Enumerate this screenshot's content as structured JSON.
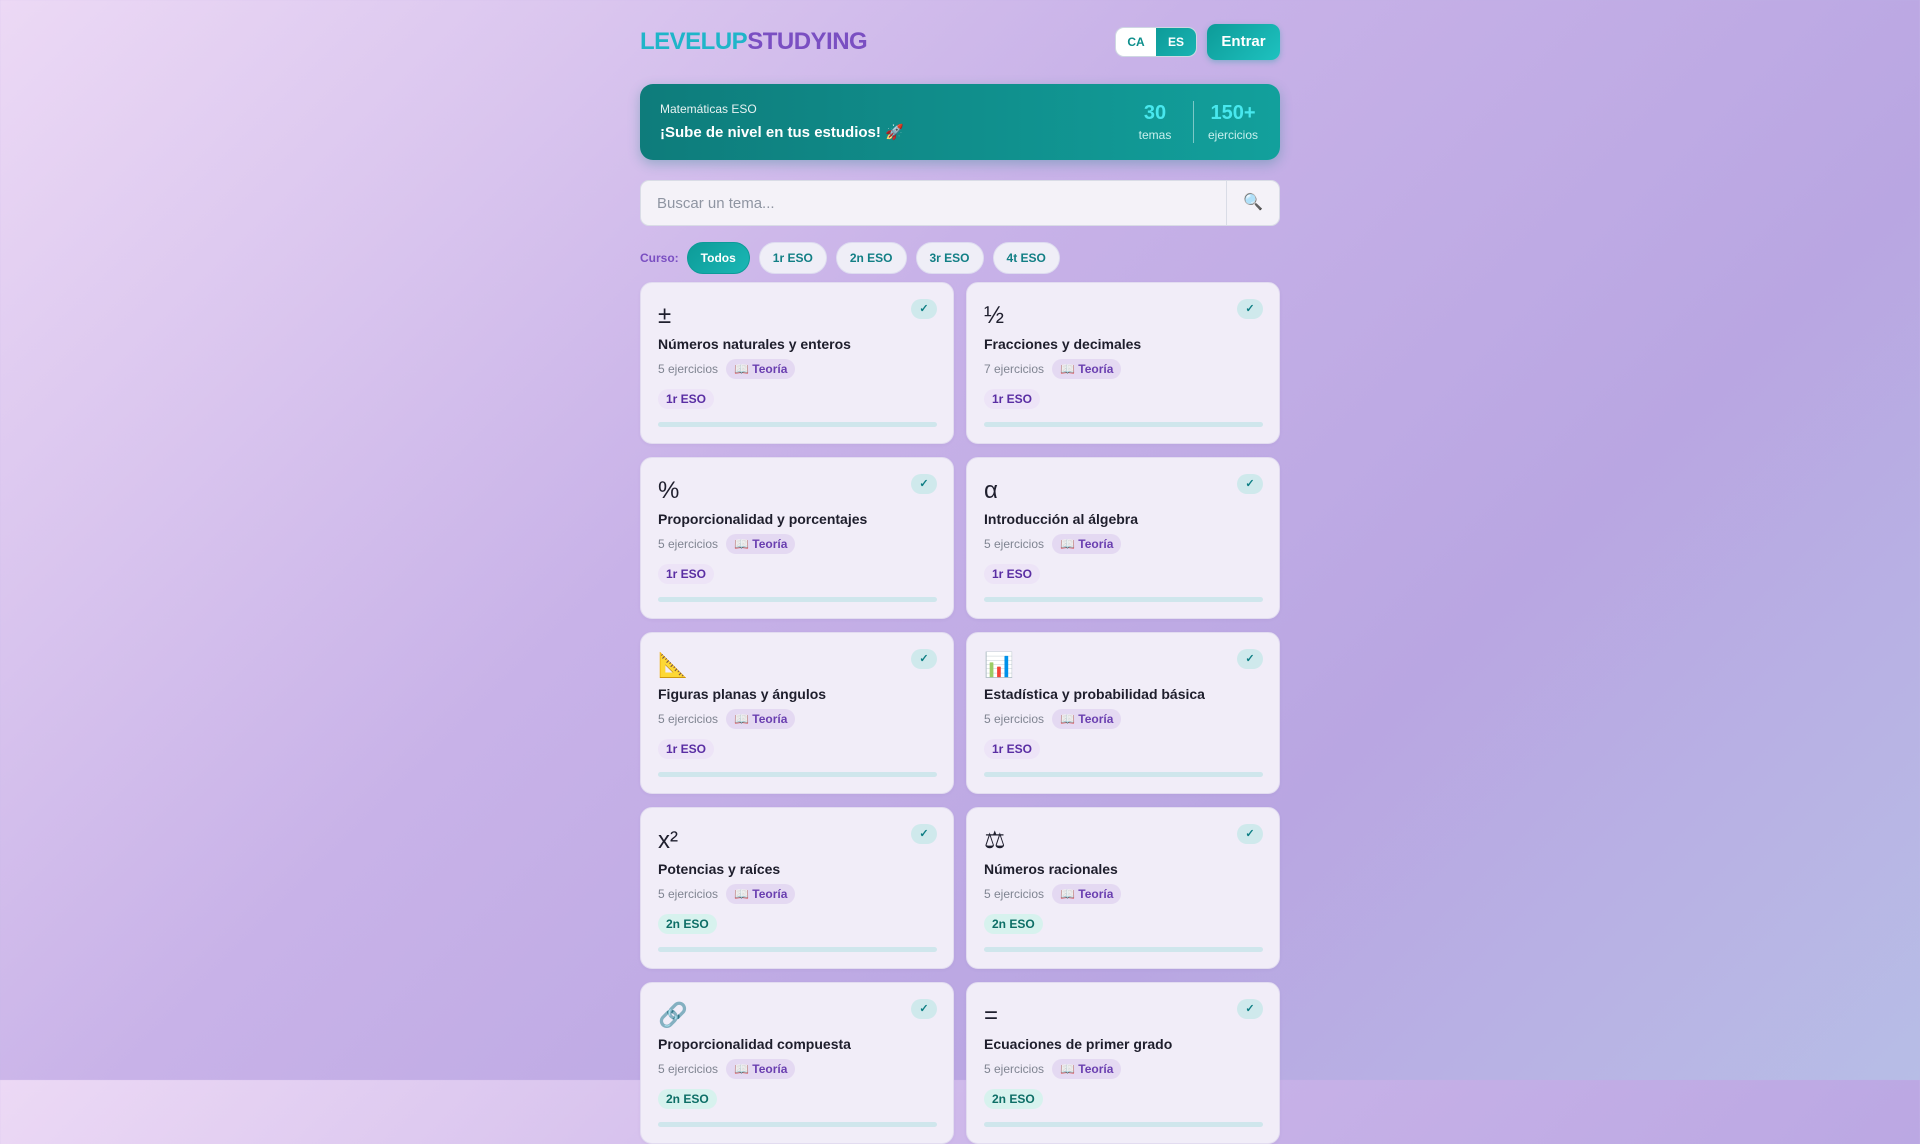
{
  "header": {
    "logo_part1": "LEVELUP",
    "logo_part2": "STUDYING",
    "lang_ca": "CA",
    "lang_es": "ES",
    "enter_label": "Entrar"
  },
  "banner": {
    "subtitle": "Matemáticas ESO",
    "title": "¡Sube de nivel en tus estudios! 🚀",
    "stat1_value": "30",
    "stat1_label": "temas",
    "stat2_value": "150+",
    "stat2_label": "ejercicios"
  },
  "search": {
    "placeholder": "Buscar un tema...",
    "icon": "🔍"
  },
  "filters": {
    "label": "Curso:",
    "chips": [
      "Todos",
      "1r ESO",
      "2n ESO",
      "3r ESO",
      "4t ESO"
    ],
    "active": "Todos"
  },
  "cards": [
    {
      "icon": "±",
      "title": "Números naturales y enteros",
      "count": "5 ejercicios",
      "theory": "📖 Teoría",
      "level": "1r ESO",
      "check": "✓",
      "progress": 0
    },
    {
      "icon": "½",
      "title": "Fracciones y decimales",
      "count": "7 ejercicios",
      "theory": "📖 Teoría",
      "level": "1r ESO",
      "check": "✓",
      "progress": 0
    },
    {
      "icon": "%",
      "title": "Proporcionalidad y porcentajes",
      "count": "5 ejercicios",
      "theory": "📖 Teoría",
      "level": "1r ESO",
      "check": "✓",
      "progress": 0
    },
    {
      "icon": "α",
      "title": "Introducción al álgebra",
      "count": "5 ejercicios",
      "theory": "📖 Teoría",
      "level": "1r ESO",
      "check": "✓",
      "progress": 0
    },
    {
      "icon": "📐",
      "title": "Figuras planas y ángulos",
      "count": "5 ejercicios",
      "theory": "📖 Teoría",
      "level": "1r ESO",
      "check": "✓",
      "progress": 0
    },
    {
      "icon": "📊",
      "title": "Estadística y probabilidad básica",
      "count": "5 ejercicios",
      "theory": "📖 Teoría",
      "level": "1r ESO",
      "check": "✓",
      "progress": 0
    },
    {
      "icon": "x²",
      "title": "Potencias y raíces",
      "count": "5 ejercicios",
      "theory": "📖 Teoría",
      "level": "2n ESO",
      "check": "✓",
      "progress": 0
    },
    {
      "icon": "⚖",
      "title": "Números racionales",
      "count": "5 ejercicios",
      "theory": "📖 Teoría",
      "level": "2n ESO",
      "check": "✓",
      "progress": 0
    },
    {
      "icon": "🔗",
      "title": "Proporcionalidad compuesta",
      "count": "5 ejercicios",
      "theory": "📖 Teoría",
      "level": "2n ESO",
      "check": "✓",
      "progress": 0
    },
    {
      "icon": "=",
      "title": "Ecuaciones de primer grado",
      "count": "5 ejercicios",
      "theory": "📖 Teoría",
      "level": "2n ESO",
      "check": "✓",
      "progress": 0
    }
  ]
}
